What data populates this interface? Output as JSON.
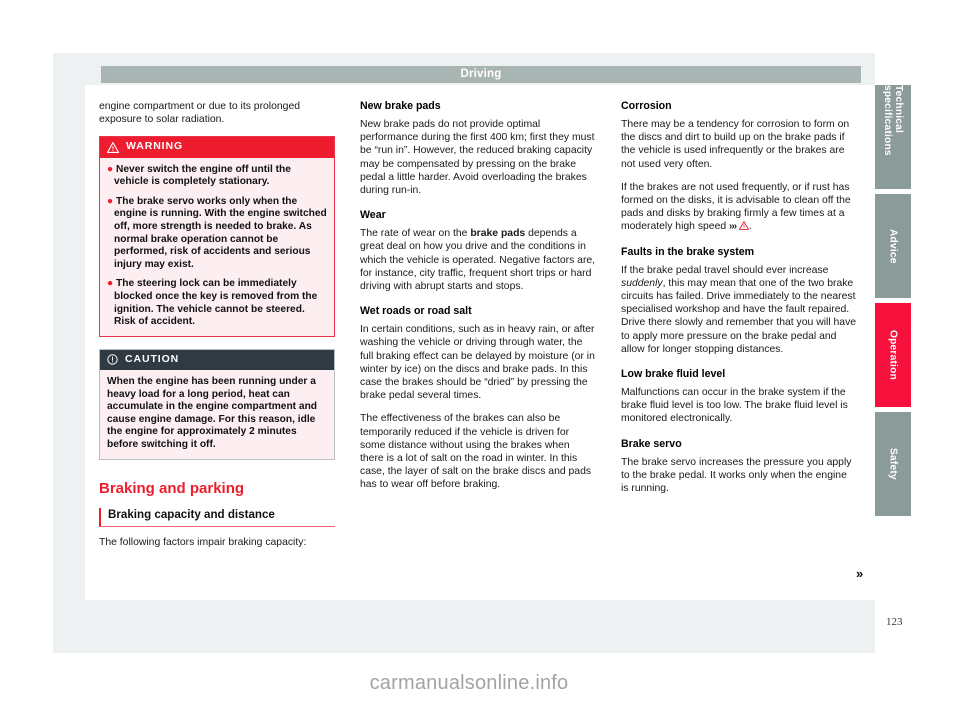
{
  "header": {
    "title": "Driving"
  },
  "page": {
    "number": "123"
  },
  "watermark": {
    "text": "carmanualsonline.info"
  },
  "column1": {
    "intro": "engine compartment or due to its prolonged exposure to solar radiation.",
    "warning": {
      "label": "WARNING",
      "icon": "warning-triangle-icon",
      "bullets": [
        "Never switch the engine off until the vehicle is completely stationary.",
        "The brake servo works only when the engine is running. With the engine switched off, more strength is needed to brake. As normal brake operation cannot be performed, risk of accidents and serious injury may exist.",
        "The steering lock can be immediately blocked once the key is removed from the ignition. The vehicle cannot be steered. Risk of accident."
      ]
    },
    "caution": {
      "label": "CAUTION",
      "icon": "circle-exclamation-icon",
      "text": "When the engine has been running under a heavy load for a long period, heat can accumulate in the engine compartment and cause engine damage. For this reason, idle the engine for approximately 2 minutes before switching it off."
    },
    "section_title": "Braking and parking",
    "subsection_title": "Braking capacity and distance",
    "after_sub": "The following factors impair braking capacity:"
  },
  "column2": {
    "heading_new_pads": "New brake pads",
    "text_new_pads": "New brake pads do not provide optimal performance during the first 400 km; first they must be “run in”. However, the reduced braking capacity may be compensated by pressing on the brake pedal a little harder. Avoid overloading the brakes during run-in.",
    "heading_wear": "Wear",
    "text_wear_a": "The rate of wear on the ",
    "text_wear_bold": "brake pads",
    "text_wear_b": " depends a great deal on how you drive and the conditions in which the vehicle is operated. Negative factors are, for instance, city traffic, frequent short trips or hard driving with abrupt starts and stops.",
    "heading_wet": "Wet roads or road salt",
    "text_wet": "In certain conditions, such as in heavy rain, or after washing the vehicle or driving through water, the full braking effect can be delayed by moisture (or in winter by ice) on the discs and brake pads. In this case the brakes should be “dried” by pressing the brake pedal several times.",
    "text_effect": "The effectiveness of the brakes can also be temporarily reduced if the vehicle is driven for some distance without using the brakes when there is a lot of salt on the road in winter. In this case, the layer of salt on the brake discs and pads has to wear off before braking."
  },
  "column3": {
    "heading_corrosion": "Corrosion",
    "text_corrosion_a": "There may be a tendency for corrosion to form on the discs and dirt to build up on the brake pads if the vehicle is used infrequently or the brakes are not used very often.",
    "text_corrosion_b": "If the brakes are not used frequently, or if rust has formed on the disks, it is advisable to clean off the pads and disks by braking firmly a few times at a moderately high speed",
    "xref_chevrons": "›››",
    "xref_suffix": ".",
    "heading_faults": "Faults in the brake system",
    "text_faults_a": "If the brake pedal travel should ever increase ",
    "text_faults_italic": "suddenly",
    "text_faults_b": ", this may mean that one of the two brake circuits has failed. Drive immediately to the nearest specialised workshop and have the fault repaired. Drive there slowly and remember that you will have to apply more pressure on the brake pedal and allow for longer stopping distances.",
    "heading_fluid": "Low brake fluid level",
    "text_fluid": "Malfunctions can occur in the brake system if the brake fluid level is too low. The brake fluid level is monitored electronically.",
    "heading_servo": "Brake servo",
    "text_servo": "The brake servo increases the pressure you apply to the brake pedal. It works only when the engine is running.",
    "continue_chevron": "››"
  },
  "rail": {
    "tabs": [
      {
        "label": "Technical specifications",
        "active": false,
        "height": 104
      },
      {
        "label": "Advice",
        "active": false,
        "height": 104
      },
      {
        "label": "Operation",
        "active": true,
        "height": 104
      },
      {
        "label": "Safety",
        "active": false,
        "height": 104
      }
    ]
  },
  "colors": {
    "accent_red": "#ed1c2e",
    "tab_active_red": "#f5113b",
    "tab_gray": "#8b9b99",
    "header_gray": "#a8b5b3",
    "caution_dark": "#2f3a42",
    "box_pink": "#fdeef1"
  }
}
